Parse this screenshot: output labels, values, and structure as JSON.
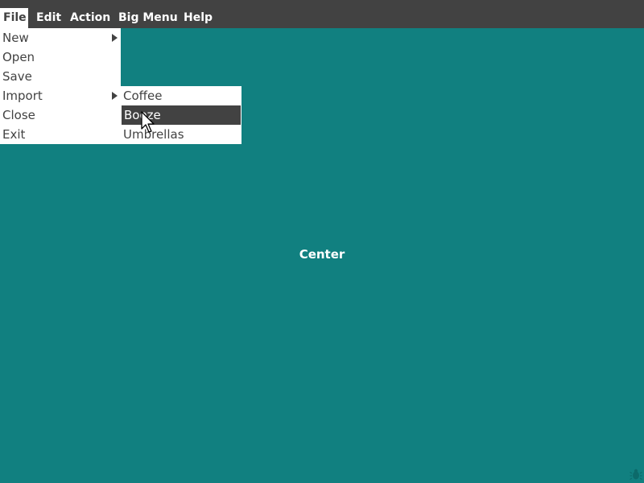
{
  "colors": {
    "desktop": "#118080",
    "menubar": "#424242",
    "menu_bg": "#ffffff",
    "text_dark": "#424242",
    "text_light": "#ffffff",
    "highlight": "#424242"
  },
  "menubar": {
    "items": [
      {
        "label": "File",
        "active": true
      },
      {
        "label": "Edit"
      },
      {
        "label": "Action"
      },
      {
        "label": "Big Menu"
      },
      {
        "label": "Help"
      }
    ]
  },
  "file_menu": {
    "items": [
      {
        "label": "New",
        "has_submenu": true
      },
      {
        "label": "Open"
      },
      {
        "label": "Save"
      },
      {
        "label": "Import",
        "has_submenu": true
      },
      {
        "label": "Close"
      },
      {
        "label": "Exit"
      }
    ]
  },
  "import_submenu": {
    "items": [
      {
        "label": "Coffee"
      },
      {
        "label": "Booze",
        "highlighted": true
      },
      {
        "label": "Umbrellas"
      }
    ]
  },
  "workspace": {
    "center_label": "Center"
  },
  "icons": {
    "cursor": "mouse-pointer-icon",
    "bug": "bug-icon"
  }
}
